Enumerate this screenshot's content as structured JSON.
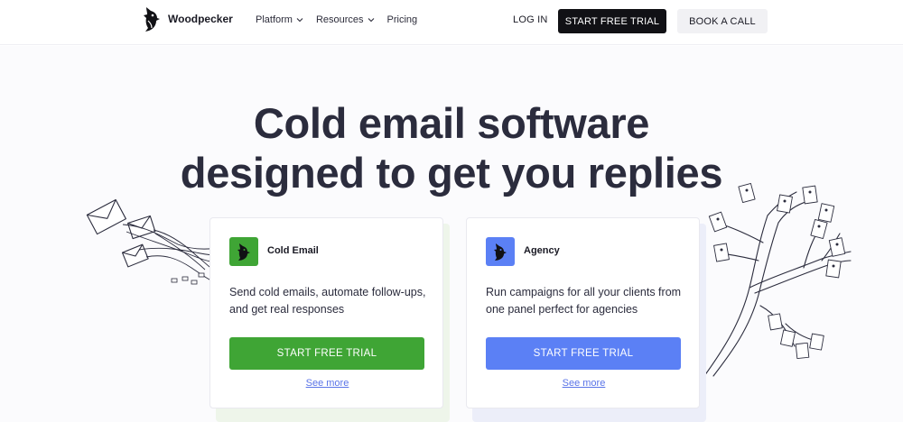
{
  "brand": {
    "name": "Woodpecker"
  },
  "nav": {
    "items": [
      {
        "label": "Platform",
        "has_dropdown": true
      },
      {
        "label": "Resources",
        "has_dropdown": true
      },
      {
        "label": "Pricing",
        "has_dropdown": false
      }
    ],
    "login_label": "LOG IN",
    "trial_label": "START FREE TRIAL",
    "call_label": "BOOK A CALL"
  },
  "hero": {
    "headline_line1": "Cold email software",
    "headline_line2": "designed to get you replies"
  },
  "cards": [
    {
      "title": "Cold Email",
      "description": "Send cold emails, automate follow-ups, and get real responses",
      "button_label": "START FREE TRIAL",
      "link_label": "See more",
      "accent_color": "#3fa535",
      "icon": "woodpecker-logo-icon"
    },
    {
      "title": "Agency",
      "description": "Run campaigns for all your clients from one panel perfect for agencies",
      "button_label": "START FREE TRIAL",
      "link_label": "See more",
      "accent_color": "#5b80f5",
      "icon": "woodpecker-logo-icon"
    }
  ],
  "colors": {
    "dark": "#111115",
    "text": "#2b2c3d",
    "link": "#5a74e8",
    "green": "#3fa535",
    "blue": "#5b80f5"
  }
}
